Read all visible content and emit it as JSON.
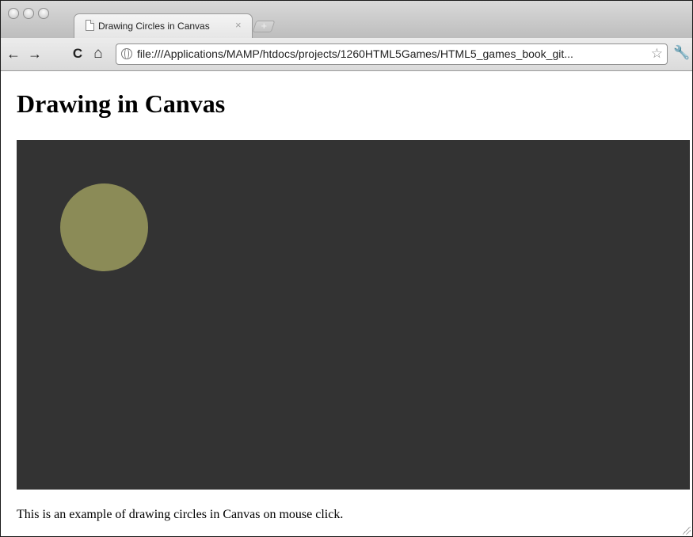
{
  "tab": {
    "title": "Drawing Circles in Canvas",
    "close_glyph": "×",
    "new_tab_glyph": "+"
  },
  "toolbar": {
    "back_glyph": "←",
    "forward_glyph": "→",
    "reload_glyph": "C",
    "home_glyph": "⌂",
    "url": "file:///Applications/MAMP/htdocs/projects/1260HTML5Games/HTML5_games_book_git...",
    "bookmark_glyph": "☆",
    "wrench_glyph": "🔧"
  },
  "page": {
    "heading": "Drawing in Canvas",
    "caption": "This is an example of drawing circles in Canvas on mouse click."
  },
  "canvas": {
    "background_color": "#333333",
    "circle_color": "#8b8b57"
  },
  "icons": {
    "traffic_lights": [
      "close-window-icon",
      "minimize-window-icon",
      "zoom-window-icon"
    ],
    "tab_icon": "page-icon",
    "security_icon": "globe-icon",
    "bookmark_icon": "star-icon",
    "menu_icon": "wrench-icon"
  }
}
